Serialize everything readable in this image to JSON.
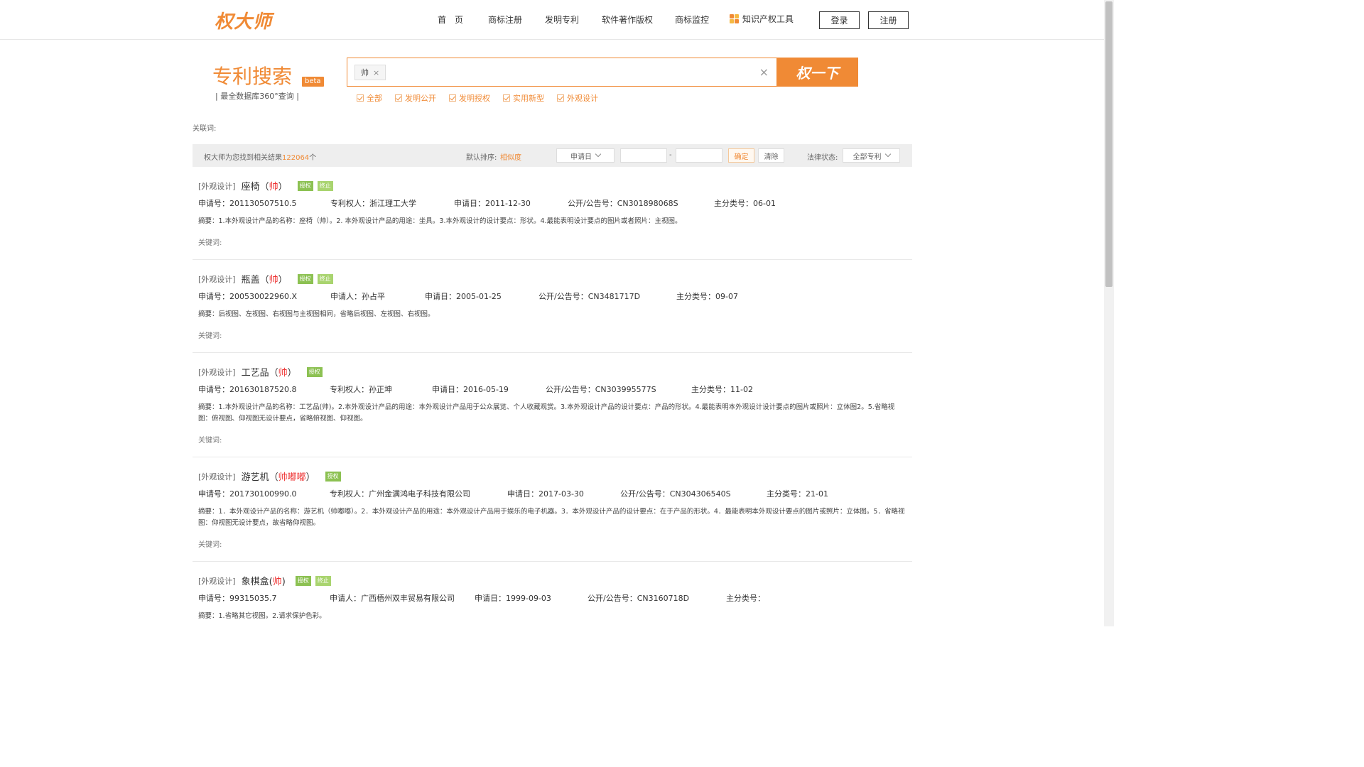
{
  "header": {
    "logo": "权大师",
    "nav": [
      "首　页",
      "商标注册",
      "发明专利",
      "软件著作版权",
      "商标监控",
      "知识产权工具"
    ],
    "login": "登录",
    "register": "注册"
  },
  "search": {
    "title": "专利搜索",
    "beta": "beta",
    "subtitle": "| 最全数据库360°查询 |",
    "chip": "帅",
    "chip_close": "×",
    "clear": "×",
    "button": "权一下",
    "filters": [
      "全部",
      "发明公开",
      "发明授权",
      "实用新型",
      "外观设计"
    ]
  },
  "related_label": "关联词:",
  "toolbar": {
    "found_prefix": "权大师为您找到相关结果",
    "found_count": "122064",
    "found_suffix": "个",
    "sort_label": "默认排序:",
    "sort_value": "相似度",
    "date_select": "申请日",
    "dash": "-",
    "confirm": "确定",
    "clear": "清除",
    "legal_label": "法律状态:",
    "legal_select": "全部专利"
  },
  "results": [
    {
      "type": "[外观设计]",
      "name_pre": "座椅（",
      "name_hl": "帅",
      "name_post": "）",
      "badges": [
        "授权",
        "终止"
      ],
      "meta": [
        "申请号：201130507510.5",
        "专利权人：浙江理工大学",
        "申请日：2011-12-30",
        "公开/公告号：CN301898068S",
        "主分类号：06-01"
      ],
      "abstract": "摘要：1.本外观设计产品的名称：座椅（帅）。2. 本外观设计产品的用途：坐具。3.本外观设计的设计要点：形状。4.最能表明设计要点的图片或者照片：主视图。",
      "keywords": "关键词:"
    },
    {
      "type": "[外观设计]",
      "name_pre": "瓶盖（",
      "name_hl": "帅",
      "name_post": "）",
      "badges": [
        "授权",
        "终止"
      ],
      "meta": [
        "申请号：200530022960.X",
        "申请人：孙占平",
        "申请日：2005-01-25",
        "公开/公告号：CN3481717D",
        "主分类号：09-07"
      ],
      "abstract": "摘要：后视图、左视图、右视图与主视图相同，省略后视图、左视图、右视图。",
      "keywords": "关键词:"
    },
    {
      "type": "[外观设计]",
      "name_pre": "工艺品（",
      "name_hl": "帅",
      "name_post": "）",
      "badges": [
        "授权"
      ],
      "meta": [
        "申请号：201630187520.8",
        "专利权人：孙正坤",
        "申请日：2016-05-19",
        "公开/公告号：CN303995577S",
        "主分类号：11-02"
      ],
      "abstract": "摘要：1.本外观设计产品的名称：工艺品(帅)。2.本外观设计产品的用途：本外观设计产品用于公众展览、个人收藏观赏。3.本外观设计产品的设计要点：产品的形状。4.最能表明本外观设计设计要点的图片或照片：立体图2。5.省略视图：俯视图、仰视图无设计要点，省略俯视图、仰视图。",
      "keywords": "关键词:"
    },
    {
      "type": "[外观设计]",
      "name_pre": "游艺机（",
      "name_hl": "帅嘟嘟",
      "name_post": "）",
      "badges": [
        "授权"
      ],
      "meta": [
        "申请号：201730100990.0",
        "专利权人：广州金满鸿电子科技有限公司",
        "申请日：2017-03-30",
        "公开/公告号：CN304306540S",
        "主分类号：21-01"
      ],
      "abstract": "摘要：1．本外观设计产品的名称：游艺机（帅嘟嘟）。2．本外观设计产品的用途：本外观设计产品用于娱乐的电子机器。3．本外观设计产品的设计要点：在于产品的形状。4．最能表明本外观设计要点的图片或照片：立体图。5．省略视图：仰视图无设计要点，故省略仰视图。",
      "keywords": "关键词:"
    },
    {
      "type": "[外观设计]",
      "name_pre": "象棋盒(",
      "name_hl": "帅",
      "name_post": ")",
      "badges": [
        "授权",
        "终止"
      ],
      "meta": [
        "申请号：99315035.7",
        "申请人：广西梧州双丰贸易有限公司",
        "申请日：1999-09-03",
        "公开/公告号：CN3160718D",
        "主分类号："
      ],
      "abstract": "摘要：1.省略其它视图。2.请求保护色彩。",
      "keywords": ""
    }
  ],
  "colors": {
    "accent": "#f08a35",
    "badge_green": "#8cc152",
    "highlight": "#e33333"
  }
}
